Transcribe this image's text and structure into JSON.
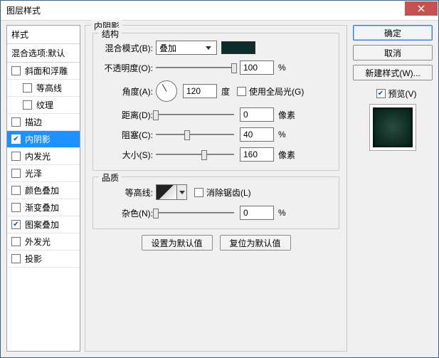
{
  "window": {
    "title": "图层样式"
  },
  "sidebar": {
    "header": "样式",
    "subheader": "混合选项:默认",
    "items": [
      {
        "label": "斜面和浮雕",
        "checked": false,
        "indent": false
      },
      {
        "label": "等高线",
        "checked": false,
        "indent": true
      },
      {
        "label": "纹理",
        "checked": false,
        "indent": true
      },
      {
        "label": "描边",
        "checked": false,
        "indent": false
      },
      {
        "label": "内阴影",
        "checked": true,
        "indent": false,
        "selected": true
      },
      {
        "label": "内发光",
        "checked": false,
        "indent": false
      },
      {
        "label": "光泽",
        "checked": false,
        "indent": false
      },
      {
        "label": "颜色叠加",
        "checked": false,
        "indent": false
      },
      {
        "label": "渐变叠加",
        "checked": false,
        "indent": false
      },
      {
        "label": "图案叠加",
        "checked": true,
        "indent": false
      },
      {
        "label": "外发光",
        "checked": false,
        "indent": false
      },
      {
        "label": "投影",
        "checked": false,
        "indent": false
      }
    ]
  },
  "panel": {
    "title": "内阴影",
    "structure": {
      "title": "结构",
      "blend_mode_label": "混合模式(B):",
      "blend_mode_value": "叠加",
      "color": "#0d2d2b",
      "opacity_label": "不透明度(O):",
      "opacity_value": "100",
      "opacity_unit": "%",
      "angle_label": "角度(A):",
      "angle_value": "120",
      "angle_unit": "度",
      "use_global_light_label": "使用全局光(G)",
      "use_global_light_checked": false,
      "distance_label": "距离(D):",
      "distance_value": "0",
      "distance_unit": "像素",
      "choke_label": "阻塞(C):",
      "choke_value": "40",
      "choke_unit": "%",
      "size_label": "大小(S):",
      "size_value": "160",
      "size_unit": "像素"
    },
    "quality": {
      "title": "品质",
      "contour_label": "等高线:",
      "antialias_label": "消除锯齿(L)",
      "antialias_checked": false,
      "noise_label": "杂色(N):",
      "noise_value": "0",
      "noise_unit": "%"
    },
    "buttons": {
      "make_default": "设置为默认值",
      "reset_default": "复位为默认值"
    }
  },
  "actions": {
    "ok": "确定",
    "cancel": "取消",
    "new_style": "新建样式(W)...",
    "preview_label": "预览(V)",
    "preview_checked": true
  }
}
